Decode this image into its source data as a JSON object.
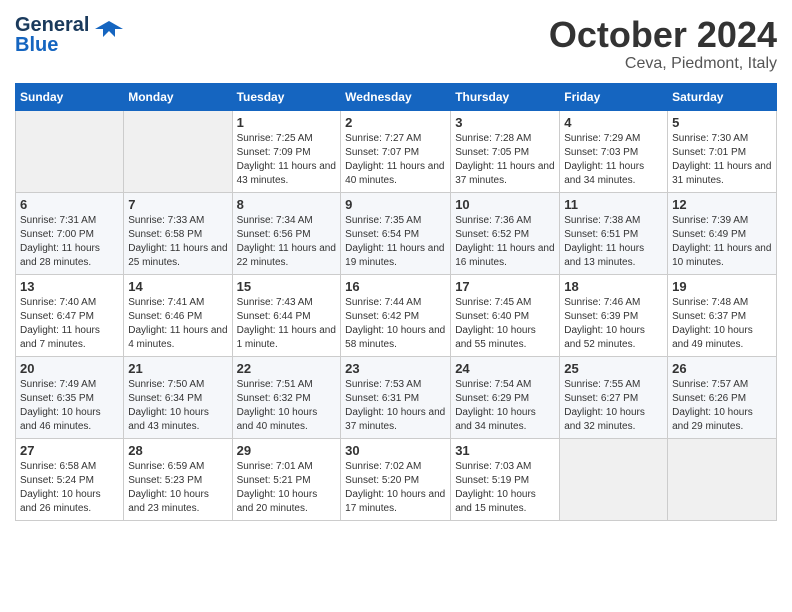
{
  "logo": {
    "line1": "General",
    "line2": "Blue"
  },
  "title": "October 2024",
  "subtitle": "Ceva, Piedmont, Italy",
  "days_header": [
    "Sunday",
    "Monday",
    "Tuesday",
    "Wednesday",
    "Thursday",
    "Friday",
    "Saturday"
  ],
  "weeks": [
    [
      {
        "num": "",
        "info": ""
      },
      {
        "num": "",
        "info": ""
      },
      {
        "num": "1",
        "info": "Sunrise: 7:25 AM\nSunset: 7:09 PM\nDaylight: 11 hours and 43 minutes."
      },
      {
        "num": "2",
        "info": "Sunrise: 7:27 AM\nSunset: 7:07 PM\nDaylight: 11 hours and 40 minutes."
      },
      {
        "num": "3",
        "info": "Sunrise: 7:28 AM\nSunset: 7:05 PM\nDaylight: 11 hours and 37 minutes."
      },
      {
        "num": "4",
        "info": "Sunrise: 7:29 AM\nSunset: 7:03 PM\nDaylight: 11 hours and 34 minutes."
      },
      {
        "num": "5",
        "info": "Sunrise: 7:30 AM\nSunset: 7:01 PM\nDaylight: 11 hours and 31 minutes."
      }
    ],
    [
      {
        "num": "6",
        "info": "Sunrise: 7:31 AM\nSunset: 7:00 PM\nDaylight: 11 hours and 28 minutes."
      },
      {
        "num": "7",
        "info": "Sunrise: 7:33 AM\nSunset: 6:58 PM\nDaylight: 11 hours and 25 minutes."
      },
      {
        "num": "8",
        "info": "Sunrise: 7:34 AM\nSunset: 6:56 PM\nDaylight: 11 hours and 22 minutes."
      },
      {
        "num": "9",
        "info": "Sunrise: 7:35 AM\nSunset: 6:54 PM\nDaylight: 11 hours and 19 minutes."
      },
      {
        "num": "10",
        "info": "Sunrise: 7:36 AM\nSunset: 6:52 PM\nDaylight: 11 hours and 16 minutes."
      },
      {
        "num": "11",
        "info": "Sunrise: 7:38 AM\nSunset: 6:51 PM\nDaylight: 11 hours and 13 minutes."
      },
      {
        "num": "12",
        "info": "Sunrise: 7:39 AM\nSunset: 6:49 PM\nDaylight: 11 hours and 10 minutes."
      }
    ],
    [
      {
        "num": "13",
        "info": "Sunrise: 7:40 AM\nSunset: 6:47 PM\nDaylight: 11 hours and 7 minutes."
      },
      {
        "num": "14",
        "info": "Sunrise: 7:41 AM\nSunset: 6:46 PM\nDaylight: 11 hours and 4 minutes."
      },
      {
        "num": "15",
        "info": "Sunrise: 7:43 AM\nSunset: 6:44 PM\nDaylight: 11 hours and 1 minute."
      },
      {
        "num": "16",
        "info": "Sunrise: 7:44 AM\nSunset: 6:42 PM\nDaylight: 10 hours and 58 minutes."
      },
      {
        "num": "17",
        "info": "Sunrise: 7:45 AM\nSunset: 6:40 PM\nDaylight: 10 hours and 55 minutes."
      },
      {
        "num": "18",
        "info": "Sunrise: 7:46 AM\nSunset: 6:39 PM\nDaylight: 10 hours and 52 minutes."
      },
      {
        "num": "19",
        "info": "Sunrise: 7:48 AM\nSunset: 6:37 PM\nDaylight: 10 hours and 49 minutes."
      }
    ],
    [
      {
        "num": "20",
        "info": "Sunrise: 7:49 AM\nSunset: 6:35 PM\nDaylight: 10 hours and 46 minutes."
      },
      {
        "num": "21",
        "info": "Sunrise: 7:50 AM\nSunset: 6:34 PM\nDaylight: 10 hours and 43 minutes."
      },
      {
        "num": "22",
        "info": "Sunrise: 7:51 AM\nSunset: 6:32 PM\nDaylight: 10 hours and 40 minutes."
      },
      {
        "num": "23",
        "info": "Sunrise: 7:53 AM\nSunset: 6:31 PM\nDaylight: 10 hours and 37 minutes."
      },
      {
        "num": "24",
        "info": "Sunrise: 7:54 AM\nSunset: 6:29 PM\nDaylight: 10 hours and 34 minutes."
      },
      {
        "num": "25",
        "info": "Sunrise: 7:55 AM\nSunset: 6:27 PM\nDaylight: 10 hours and 32 minutes."
      },
      {
        "num": "26",
        "info": "Sunrise: 7:57 AM\nSunset: 6:26 PM\nDaylight: 10 hours and 29 minutes."
      }
    ],
    [
      {
        "num": "27",
        "info": "Sunrise: 6:58 AM\nSunset: 5:24 PM\nDaylight: 10 hours and 26 minutes."
      },
      {
        "num": "28",
        "info": "Sunrise: 6:59 AM\nSunset: 5:23 PM\nDaylight: 10 hours and 23 minutes."
      },
      {
        "num": "29",
        "info": "Sunrise: 7:01 AM\nSunset: 5:21 PM\nDaylight: 10 hours and 20 minutes."
      },
      {
        "num": "30",
        "info": "Sunrise: 7:02 AM\nSunset: 5:20 PM\nDaylight: 10 hours and 17 minutes."
      },
      {
        "num": "31",
        "info": "Sunrise: 7:03 AM\nSunset: 5:19 PM\nDaylight: 10 hours and 15 minutes."
      },
      {
        "num": "",
        "info": ""
      },
      {
        "num": "",
        "info": ""
      }
    ]
  ]
}
